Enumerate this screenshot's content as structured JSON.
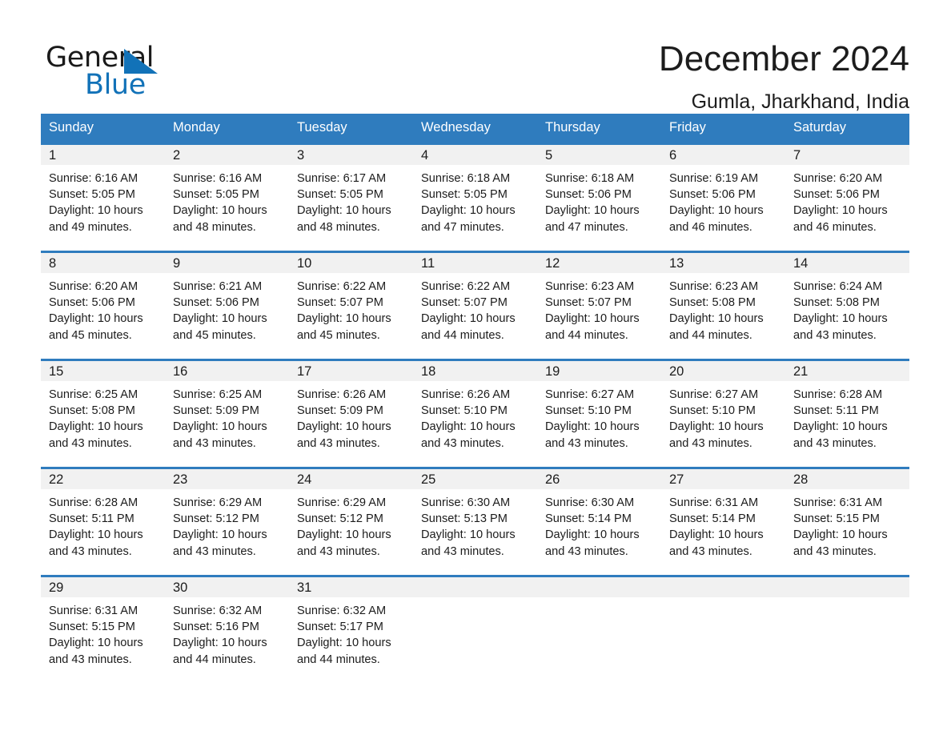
{
  "brand": {
    "word1": "General",
    "word2": "Blue",
    "triangle_color": "#1272b8",
    "icon": "triangle-logo-icon"
  },
  "header": {
    "title": "December 2024",
    "subtitle": "Gumla, Jharkhand, India"
  },
  "colors": {
    "header_blue": "#2f7cbe",
    "row_divider_blue": "#2f7cbe",
    "daynum_band": "#f1f1f1",
    "text": "#1c1c1c",
    "page_bg": "#ffffff"
  },
  "calendar": {
    "weekday_headers": [
      "Sunday",
      "Monday",
      "Tuesday",
      "Wednesday",
      "Thursday",
      "Friday",
      "Saturday"
    ],
    "labels": {
      "sunrise": "Sunrise:",
      "sunset": "Sunset:",
      "daylight": "Daylight:"
    },
    "weeks": [
      [
        {
          "day": "1",
          "sunrise": "Sunrise: 6:16 AM",
          "sunset": "Sunset: 5:05 PM",
          "daylight_l1": "Daylight: 10 hours",
          "daylight_l2": "and 49 minutes."
        },
        {
          "day": "2",
          "sunrise": "Sunrise: 6:16 AM",
          "sunset": "Sunset: 5:05 PM",
          "daylight_l1": "Daylight: 10 hours",
          "daylight_l2": "and 48 minutes."
        },
        {
          "day": "3",
          "sunrise": "Sunrise: 6:17 AM",
          "sunset": "Sunset: 5:05 PM",
          "daylight_l1": "Daylight: 10 hours",
          "daylight_l2": "and 48 minutes."
        },
        {
          "day": "4",
          "sunrise": "Sunrise: 6:18 AM",
          "sunset": "Sunset: 5:05 PM",
          "daylight_l1": "Daylight: 10 hours",
          "daylight_l2": "and 47 minutes."
        },
        {
          "day": "5",
          "sunrise": "Sunrise: 6:18 AM",
          "sunset": "Sunset: 5:06 PM",
          "daylight_l1": "Daylight: 10 hours",
          "daylight_l2": "and 47 minutes."
        },
        {
          "day": "6",
          "sunrise": "Sunrise: 6:19 AM",
          "sunset": "Sunset: 5:06 PM",
          "daylight_l1": "Daylight: 10 hours",
          "daylight_l2": "and 46 minutes."
        },
        {
          "day": "7",
          "sunrise": "Sunrise: 6:20 AM",
          "sunset": "Sunset: 5:06 PM",
          "daylight_l1": "Daylight: 10 hours",
          "daylight_l2": "and 46 minutes."
        }
      ],
      [
        {
          "day": "8",
          "sunrise": "Sunrise: 6:20 AM",
          "sunset": "Sunset: 5:06 PM",
          "daylight_l1": "Daylight: 10 hours",
          "daylight_l2": "and 45 minutes."
        },
        {
          "day": "9",
          "sunrise": "Sunrise: 6:21 AM",
          "sunset": "Sunset: 5:06 PM",
          "daylight_l1": "Daylight: 10 hours",
          "daylight_l2": "and 45 minutes."
        },
        {
          "day": "10",
          "sunrise": "Sunrise: 6:22 AM",
          "sunset": "Sunset: 5:07 PM",
          "daylight_l1": "Daylight: 10 hours",
          "daylight_l2": "and 45 minutes."
        },
        {
          "day": "11",
          "sunrise": "Sunrise: 6:22 AM",
          "sunset": "Sunset: 5:07 PM",
          "daylight_l1": "Daylight: 10 hours",
          "daylight_l2": "and 44 minutes."
        },
        {
          "day": "12",
          "sunrise": "Sunrise: 6:23 AM",
          "sunset": "Sunset: 5:07 PM",
          "daylight_l1": "Daylight: 10 hours",
          "daylight_l2": "and 44 minutes."
        },
        {
          "day": "13",
          "sunrise": "Sunrise: 6:23 AM",
          "sunset": "Sunset: 5:08 PM",
          "daylight_l1": "Daylight: 10 hours",
          "daylight_l2": "and 44 minutes."
        },
        {
          "day": "14",
          "sunrise": "Sunrise: 6:24 AM",
          "sunset": "Sunset: 5:08 PM",
          "daylight_l1": "Daylight: 10 hours",
          "daylight_l2": "and 43 minutes."
        }
      ],
      [
        {
          "day": "15",
          "sunrise": "Sunrise: 6:25 AM",
          "sunset": "Sunset: 5:08 PM",
          "daylight_l1": "Daylight: 10 hours",
          "daylight_l2": "and 43 minutes."
        },
        {
          "day": "16",
          "sunrise": "Sunrise: 6:25 AM",
          "sunset": "Sunset: 5:09 PM",
          "daylight_l1": "Daylight: 10 hours",
          "daylight_l2": "and 43 minutes."
        },
        {
          "day": "17",
          "sunrise": "Sunrise: 6:26 AM",
          "sunset": "Sunset: 5:09 PM",
          "daylight_l1": "Daylight: 10 hours",
          "daylight_l2": "and 43 minutes."
        },
        {
          "day": "18",
          "sunrise": "Sunrise: 6:26 AM",
          "sunset": "Sunset: 5:10 PM",
          "daylight_l1": "Daylight: 10 hours",
          "daylight_l2": "and 43 minutes."
        },
        {
          "day": "19",
          "sunrise": "Sunrise: 6:27 AM",
          "sunset": "Sunset: 5:10 PM",
          "daylight_l1": "Daylight: 10 hours",
          "daylight_l2": "and 43 minutes."
        },
        {
          "day": "20",
          "sunrise": "Sunrise: 6:27 AM",
          "sunset": "Sunset: 5:10 PM",
          "daylight_l1": "Daylight: 10 hours",
          "daylight_l2": "and 43 minutes."
        },
        {
          "day": "21",
          "sunrise": "Sunrise: 6:28 AM",
          "sunset": "Sunset: 5:11 PM",
          "daylight_l1": "Daylight: 10 hours",
          "daylight_l2": "and 43 minutes."
        }
      ],
      [
        {
          "day": "22",
          "sunrise": "Sunrise: 6:28 AM",
          "sunset": "Sunset: 5:11 PM",
          "daylight_l1": "Daylight: 10 hours",
          "daylight_l2": "and 43 minutes."
        },
        {
          "day": "23",
          "sunrise": "Sunrise: 6:29 AM",
          "sunset": "Sunset: 5:12 PM",
          "daylight_l1": "Daylight: 10 hours",
          "daylight_l2": "and 43 minutes."
        },
        {
          "day": "24",
          "sunrise": "Sunrise: 6:29 AM",
          "sunset": "Sunset: 5:12 PM",
          "daylight_l1": "Daylight: 10 hours",
          "daylight_l2": "and 43 minutes."
        },
        {
          "day": "25",
          "sunrise": "Sunrise: 6:30 AM",
          "sunset": "Sunset: 5:13 PM",
          "daylight_l1": "Daylight: 10 hours",
          "daylight_l2": "and 43 minutes."
        },
        {
          "day": "26",
          "sunrise": "Sunrise: 6:30 AM",
          "sunset": "Sunset: 5:14 PM",
          "daylight_l1": "Daylight: 10 hours",
          "daylight_l2": "and 43 minutes."
        },
        {
          "day": "27",
          "sunrise": "Sunrise: 6:31 AM",
          "sunset": "Sunset: 5:14 PM",
          "daylight_l1": "Daylight: 10 hours",
          "daylight_l2": "and 43 minutes."
        },
        {
          "day": "28",
          "sunrise": "Sunrise: 6:31 AM",
          "sunset": "Sunset: 5:15 PM",
          "daylight_l1": "Daylight: 10 hours",
          "daylight_l2": "and 43 minutes."
        }
      ],
      [
        {
          "day": "29",
          "sunrise": "Sunrise: 6:31 AM",
          "sunset": "Sunset: 5:15 PM",
          "daylight_l1": "Daylight: 10 hours",
          "daylight_l2": "and 43 minutes."
        },
        {
          "day": "30",
          "sunrise": "Sunrise: 6:32 AM",
          "sunset": "Sunset: 5:16 PM",
          "daylight_l1": "Daylight: 10 hours",
          "daylight_l2": "and 44 minutes."
        },
        {
          "day": "31",
          "sunrise": "Sunrise: 6:32 AM",
          "sunset": "Sunset: 5:17 PM",
          "daylight_l1": "Daylight: 10 hours",
          "daylight_l2": "and 44 minutes."
        },
        {
          "day": "",
          "sunrise": "",
          "sunset": "",
          "daylight_l1": "",
          "daylight_l2": ""
        },
        {
          "day": "",
          "sunrise": "",
          "sunset": "",
          "daylight_l1": "",
          "daylight_l2": ""
        },
        {
          "day": "",
          "sunrise": "",
          "sunset": "",
          "daylight_l1": "",
          "daylight_l2": ""
        },
        {
          "day": "",
          "sunrise": "",
          "sunset": "",
          "daylight_l1": "",
          "daylight_l2": ""
        }
      ]
    ]
  }
}
